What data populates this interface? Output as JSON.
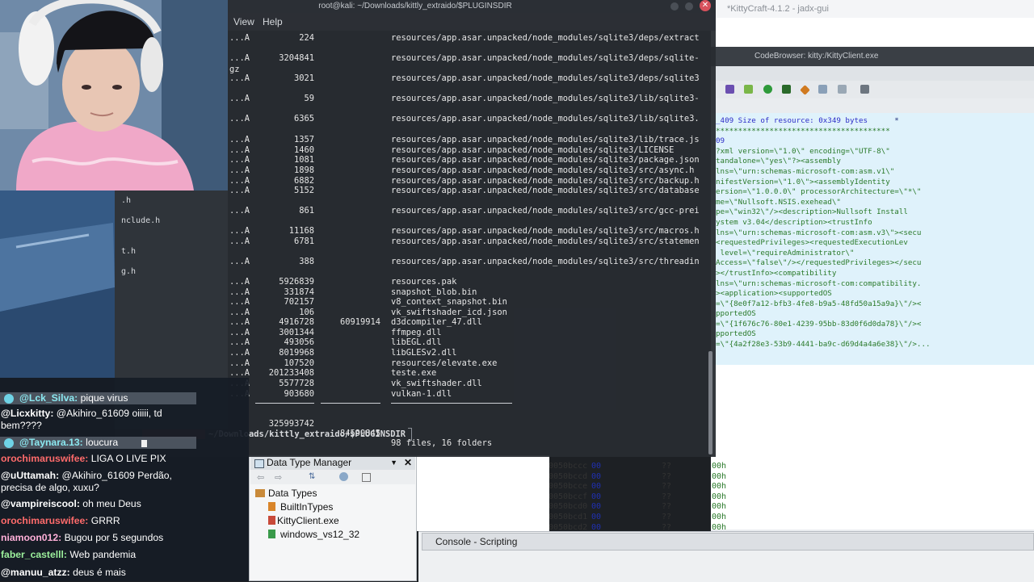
{
  "jadx_title": "*KittyCraft-4.1.2 - jadx-gui",
  "codebrowser_title": "CodeBrowser: kitty:/KittyClient.exe",
  "terminal": {
    "title": "root@kali: ~/Downloads/kittly_extraido/$PLUGINSDIR",
    "menu": [
      "View",
      "Help"
    ],
    "close_glyph": "✕",
    "gz": "gz",
    "rows": [
      {
        "att": "...A",
        "size": "224",
        "comp": "",
        "name": "resources/app.asar.unpacked/node_modules/sqlite3/deps/extract"
      },
      {
        "att": "...A",
        "size": "3204841",
        "comp": "",
        "name": "resources/app.asar.unpacked/node_modules/sqlite3/deps/sqlite-"
      },
      {
        "att": "...A",
        "size": "3021",
        "comp": "",
        "name": "resources/app.asar.unpacked/node_modules/sqlite3/deps/sqlite3"
      },
      {
        "att": "...A",
        "size": "59",
        "comp": "",
        "name": "resources/app.asar.unpacked/node_modules/sqlite3/lib/sqlite3-"
      },
      {
        "att": "...A",
        "size": "6365",
        "comp": "",
        "name": "resources/app.asar.unpacked/node_modules/sqlite3/lib/sqlite3."
      },
      {
        "att": "...A",
        "size": "1357",
        "comp": "",
        "name": "resources/app.asar.unpacked/node_modules/sqlite3/lib/trace.js"
      },
      {
        "att": "...A",
        "size": "1460",
        "comp": "",
        "name": "resources/app.asar.unpacked/node_modules/sqlite3/LICENSE"
      },
      {
        "att": "...A",
        "size": "1081",
        "comp": "",
        "name": "resources/app.asar.unpacked/node_modules/sqlite3/package.json"
      },
      {
        "att": "...A",
        "size": "1898",
        "comp": "",
        "name": "resources/app.asar.unpacked/node_modules/sqlite3/src/async.h"
      },
      {
        "att": "...A",
        "size": "6882",
        "comp": "",
        "name": "resources/app.asar.unpacked/node_modules/sqlite3/src/backup.h"
      },
      {
        "att": "...A",
        "size": "5152",
        "comp": "",
        "name": "resources/app.asar.unpacked/node_modules/sqlite3/src/database"
      },
      {
        "att": "...A",
        "size": "861",
        "comp": "",
        "name": "resources/app.asar.unpacked/node_modules/sqlite3/src/gcc-prei"
      },
      {
        "att": "...A",
        "size": "11168",
        "comp": "",
        "name": "resources/app.asar.unpacked/node_modules/sqlite3/src/macros.h"
      },
      {
        "att": "...A",
        "size": "6781",
        "comp": "",
        "name": "resources/app.asar.unpacked/node_modules/sqlite3/src/statemen"
      },
      {
        "att": "...A",
        "size": "388",
        "comp": "",
        "name": "resources/app.asar.unpacked/node_modules/sqlite3/src/threadin"
      },
      {
        "att": "...A",
        "size": "5926839",
        "comp": "",
        "name": "resources.pak"
      },
      {
        "att": "...A",
        "size": "331874",
        "comp": "",
        "name": "snapshot_blob.bin"
      },
      {
        "att": "...A",
        "size": "702157",
        "comp": "",
        "name": "v8_context_snapshot.bin"
      },
      {
        "att": "...A",
        "size": "106",
        "comp": "",
        "name": "vk_swiftshader_icd.json"
      },
      {
        "att": "...A",
        "size": "4916728",
        "comp": "60919914",
        "name": "d3dcompiler_47.dll"
      },
      {
        "att": "...A",
        "size": "3001344",
        "comp": "",
        "name": "ffmpeg.dll"
      },
      {
        "att": "...A",
        "size": "493056",
        "comp": "",
        "name": "libEGL.dll"
      },
      {
        "att": "...A",
        "size": "8019968",
        "comp": "",
        "name": "libGLESv2.dll"
      },
      {
        "att": "...A",
        "size": "107520",
        "comp": "",
        "name": "resources/elevate.exe"
      },
      {
        "att": "...A",
        "size": "201233408",
        "comp": "",
        "name": "teste.exe"
      },
      {
        "att": "...A",
        "size": "5577728",
        "comp": "",
        "name": "vk_swiftshader.dll"
      },
      {
        "att": "...A",
        "size": "903680",
        "comp": "",
        "name": "vulkan-1.dll"
      }
    ],
    "total": {
      "size": "325993742",
      "comp": "84599845",
      "summary": "98 files, 16 folders"
    },
    "prompt": "~/Downloads/kittly_extraido/$PLUGINSDIR"
  },
  "side_files": [
    ".h",
    "nclude.h",
    "t.h",
    "g.h"
  ],
  "listing": {
    "line1": "_409 Size of resource: 0x349 bytes",
    "line2": "09",
    "lines": [
      "?xml version=\\\"1.0\\\" encoding=\\\"UTF-8\\\"",
      "tandalone=\\\"yes\\\"?><assembly",
      "lns=\\\"urn:schemas-microsoft-com:asm.v1\\\"",
      "nifestVersion=\\\"1.0\\\"><assemblyIdentity",
      "ersion=\\\"1.0.0.0\\\" processorArchitecture=\\\"*\\\"",
      "me=\\\"Nullsoft.NSIS.exehead\\\"",
      "pe=\\\"win32\\\"/><description>Nullsoft Install",
      "ystem v3.04</description><trustInfo",
      "lns=\\\"urn:schemas-microsoft-com:asm.v3\\\"><secu",
      "<requestedPrivileges><requestedExecutionLev",
      " level=\\\"requireAdministrator\\\"",
      "Access=\\\"false\\\"/></requestedPrivileges></secu",
      "></trustInfo><compatibility",
      "lns=\\\"urn:schemas-microsoft-com:compatibility.",
      "><application><supportedOS",
      "=\\\"{8e0f7a12-bfb3-4fe8-b9a5-48fd50a15a9a}\\\"/><",
      "pportedOS",
      "=\\\"{1f676c76-80e1-4239-95bb-83d0f6d0da78}\\\"/><",
      "pportedOS",
      "=\\\"{4a2f28e3-53b9-4441-ba9c-d69d4a4a6e38}\\\"/>..."
    ]
  },
  "hex_rows": [
    {
      "addr": "0050bccc",
      "val": "00",
      "q": "??",
      "h": "00h"
    },
    {
      "addr": "0050bccd",
      "val": "00",
      "q": "??",
      "h": "00h"
    },
    {
      "addr": "0050bcce",
      "val": "00",
      "q": "??",
      "h": "00h"
    },
    {
      "addr": "0050bccf",
      "val": "00",
      "q": "??",
      "h": "00h"
    },
    {
      "addr": "0050bcd0",
      "val": "00",
      "q": "??",
      "h": "00h"
    },
    {
      "addr": "0050bcd1",
      "val": "00",
      "q": "??",
      "h": "00h"
    },
    {
      "addr": "0050bcd2",
      "val": "00",
      "q": "??",
      "h": "00h"
    }
  ],
  "data_type_manager": {
    "title": "Data Type Manager",
    "root": "Data Types",
    "items": [
      "BuiltInTypes",
      "KittyClient.exe",
      "windows_vs12_32"
    ]
  },
  "console_title": "Console - Scripting",
  "chat": [
    {
      "user": "@Lck_Silva:",
      "msg": "pique virus",
      "color": "u-cyan",
      "hl": true
    },
    {
      "user": "@Licxkitty:",
      "msg": "@Akihiro_61609 oiiiii, td",
      "color": "u-white",
      "hl": false
    },
    {
      "user": "",
      "msg": "bem????",
      "color": "u-white",
      "hl": false
    },
    {
      "user": "@Taynara.13:",
      "msg": "loucura",
      "color": "u-cyan",
      "hl": true
    },
    {
      "user": "orochimaruswifee:",
      "msg": "LIGA O LIVE PIX",
      "color": "u-red",
      "hl": false
    },
    {
      "user": "@uUttamah:",
      "msg": "@Akihiro_61609 Perdão,",
      "color": "u-white",
      "hl": false
    },
    {
      "user": "",
      "msg": "precisa de algo, xuxu?",
      "color": "u-white",
      "hl": false
    },
    {
      "user": "@vampireiscool:",
      "msg": "oh meu Deus",
      "color": "u-white",
      "hl": false
    },
    {
      "user": "orochimaruswifee:",
      "msg": "GRRR",
      "color": "u-red",
      "hl": false
    },
    {
      "user": "niamoon012:",
      "msg": "Bugou por 5 segundos",
      "color": "u-pink",
      "hl": false
    },
    {
      "user": "faber_castelll:",
      "msg": "Web pandemia",
      "color": "u-green",
      "hl": false
    },
    {
      "user": "@manuu_atzz:",
      "msg": "deus é mais",
      "color": "u-white",
      "hl": false
    }
  ]
}
